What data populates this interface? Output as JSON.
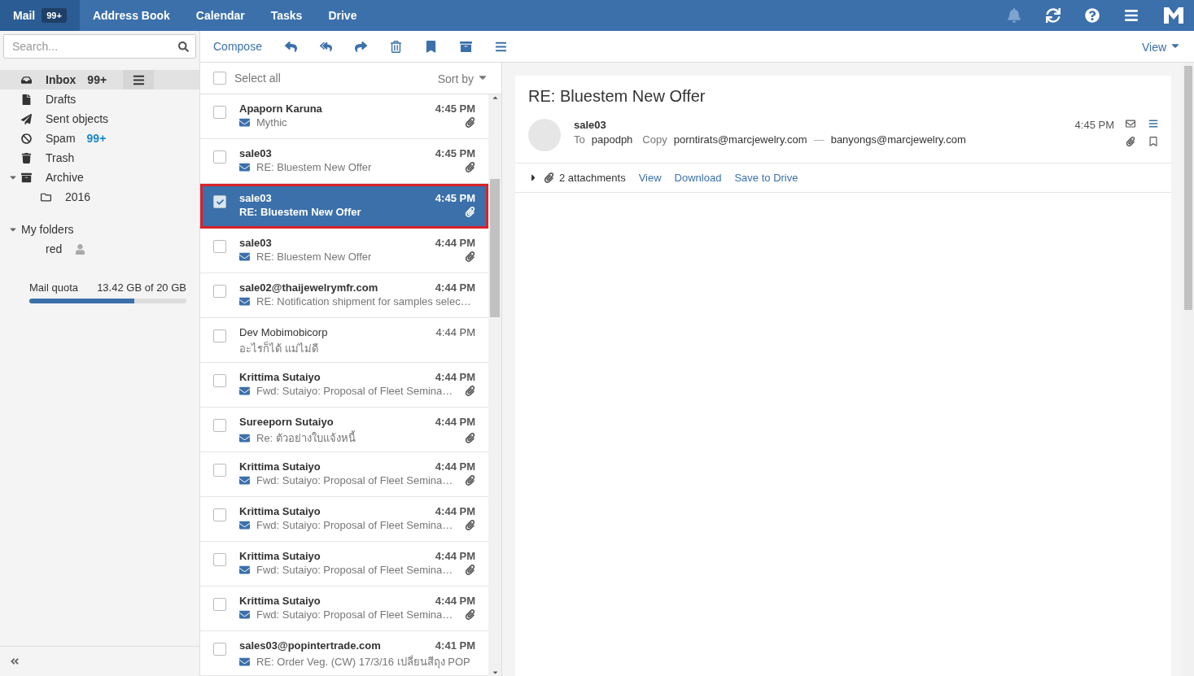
{
  "top_nav": {
    "tabs": [
      {
        "label": "Mail",
        "badge": "99+",
        "selected": true
      },
      {
        "label": "Address Book",
        "selected": false
      },
      {
        "label": "Calendar",
        "selected": false
      },
      {
        "label": "Tasks",
        "selected": false
      },
      {
        "label": "Drive",
        "selected": false
      }
    ]
  },
  "sidebar": {
    "search": {
      "placeholder": "Search..."
    },
    "folders": [
      {
        "label": "Inbox",
        "kind": "inbox",
        "count": "99+",
        "selected": true
      },
      {
        "label": "Drafts",
        "kind": "drafts",
        "selected": false
      },
      {
        "label": "Sent objects",
        "kind": "sent",
        "selected": false
      },
      {
        "label": "Spam",
        "kind": "spam",
        "count": "99+",
        "selected": false
      },
      {
        "label": "Trash",
        "kind": "trash",
        "selected": false
      },
      {
        "label": "Archive",
        "kind": "archive",
        "selected": false,
        "expanded": true,
        "children": [
          {
            "label": "2016",
            "kind": "folder",
            "selected": false
          }
        ]
      }
    ],
    "my_folders": {
      "label": "My folders",
      "expanded": true,
      "children": [
        {
          "label": "red",
          "shared": true,
          "selected": false
        }
      ]
    },
    "quota": {
      "label": "Mail quota",
      "reading": "13.42 GB of 20 GB",
      "level": 0.67
    }
  },
  "toolbar": {
    "compose": "Compose",
    "view": "View"
  },
  "list": {
    "select_all": "Select all",
    "select_all_checked": false,
    "sort": "Sort by",
    "messages": [
      {
        "sender": "Apaporn Karuna",
        "subject": "Mythic",
        "time": "4:45 PM",
        "unread": true,
        "attachment": true,
        "selected": false,
        "checked": false
      },
      {
        "sender": "sale03",
        "subject": "RE: Bluestem New Offer",
        "time": "4:45 PM",
        "unread": true,
        "attachment": true,
        "selected": false,
        "checked": false
      },
      {
        "sender": "sale03",
        "subject": "RE: Bluestem New Offer",
        "time": "4:45 PM",
        "unread": true,
        "attachment": true,
        "selected": true,
        "checked": true
      },
      {
        "sender": "sale03",
        "subject": "RE: Bluestem New Offer",
        "time": "4:44 PM",
        "unread": true,
        "attachment": true,
        "selected": false,
        "checked": false
      },
      {
        "sender": "sale02@thaijewelrymfr.com",
        "subject": "RE: Notification shipment for samples selec…",
        "time": "4:44 PM",
        "unread": true,
        "attachment": false,
        "selected": false,
        "checked": false
      },
      {
        "sender": "Dev Mobimobicorp",
        "subject": "อะไรก็ได้ แม่ไม่ดี",
        "time": "4:44 PM",
        "unread": false,
        "attachment": false,
        "selected": false,
        "checked": false
      },
      {
        "sender": "Krittima Sutaiyo",
        "subject": "Fwd: Sutaiyo: Proposal of Fleet Semina…",
        "time": "4:44 PM",
        "unread": true,
        "attachment": true,
        "selected": false,
        "checked": false
      },
      {
        "sender": "Sureeporn Sutaiyo",
        "subject": "Re: ตัวอย่างใบแจ้งหนี้",
        "time": "4:44 PM",
        "unread": true,
        "attachment": true,
        "selected": false,
        "checked": false
      },
      {
        "sender": "Krittima Sutaiyo",
        "subject": "Fwd: Sutaiyo: Proposal of Fleet Semina…",
        "time": "4:44 PM",
        "unread": true,
        "attachment": true,
        "selected": false,
        "checked": false
      },
      {
        "sender": "Krittima Sutaiyo",
        "subject": "Fwd: Sutaiyo: Proposal of Fleet Semina…",
        "time": "4:44 PM",
        "unread": true,
        "attachment": true,
        "selected": false,
        "checked": false
      },
      {
        "sender": "Krittima Sutaiyo",
        "subject": "Fwd: Sutaiyo: Proposal of Fleet Semina…",
        "time": "4:44 PM",
        "unread": true,
        "attachment": true,
        "selected": false,
        "checked": false
      },
      {
        "sender": "Krittima Sutaiyo",
        "subject": "Fwd: Sutaiyo: Proposal of Fleet Semina…",
        "time": "4:44 PM",
        "unread": true,
        "attachment": true,
        "selected": false,
        "checked": false
      },
      {
        "sender": "sales03@popintertrade.com",
        "subject": "RE: Order Veg. (CW) 17/3/16 เปลี่ยนสีถุง POP",
        "time": "4:41 PM",
        "unread": true,
        "attachment": false,
        "selected": false,
        "checked": false
      }
    ]
  },
  "reader": {
    "title": "RE: Bluestem New Offer",
    "sender": "sale03",
    "to_label": "To",
    "to": "papodph",
    "copy_label": "Copy",
    "copy": [
      "porntirats@marcjewelry.com",
      "banyongs@marcjewelry.com"
    ],
    "separator": "—",
    "time": "4:45 PM",
    "attachments": {
      "count": "2 attachments",
      "expanded": false,
      "actions": [
        "View",
        "Download",
        "Save to Drive"
      ]
    }
  }
}
